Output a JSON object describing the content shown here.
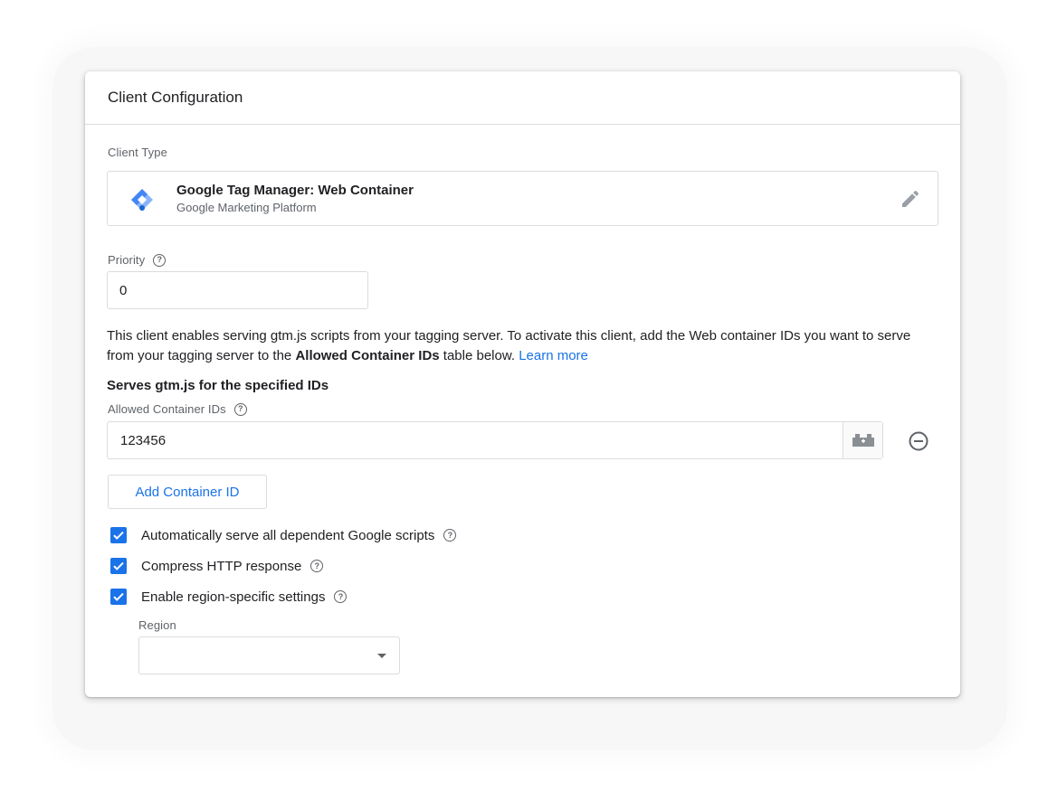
{
  "card": {
    "title": "Client Configuration"
  },
  "client_type": {
    "label": "Client Type",
    "name": "Google Tag Manager: Web Container",
    "provider": "Google Marketing Platform",
    "logo_icon": "gtm-diamond-icon",
    "edit_icon": "pencil-icon"
  },
  "priority": {
    "label": "Priority",
    "value": "0",
    "help_icon": "help-circle-icon"
  },
  "description": {
    "text_before": "This client enables serving gtm.js scripts from your tagging server. To activate this client, add the Web container IDs you want to serve from your tagging server to the ",
    "bold": "Allowed Container IDs",
    "text_after": " table below. ",
    "link": "Learn more"
  },
  "serves": {
    "title": "Serves gtm.js for the specified IDs",
    "label": "Allowed Container IDs",
    "ids": [
      "123456"
    ],
    "variable_icon": "variable-brick-icon",
    "remove_icon": "remove-circle-icon",
    "add_button": "Add Container ID"
  },
  "options": [
    {
      "label": "Automatically serve all dependent Google scripts",
      "checked": true
    },
    {
      "label": "Compress HTTP response",
      "checked": true
    },
    {
      "label": "Enable region-specific settings",
      "checked": true
    }
  ],
  "region": {
    "label": "Region",
    "value": ""
  },
  "colors": {
    "accent": "#1a73e8",
    "border": "#dadce0",
    "muted": "#5f6368"
  }
}
